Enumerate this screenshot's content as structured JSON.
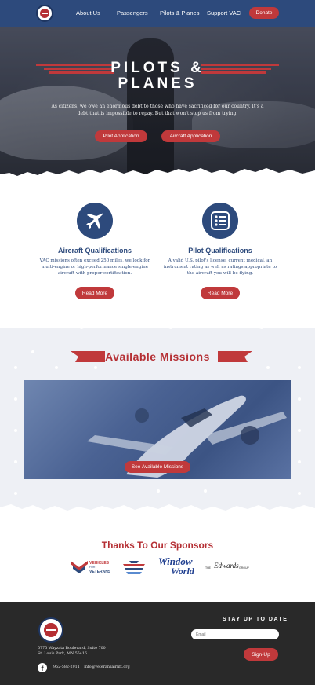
{
  "nav": {
    "links": [
      "About Us",
      "Passengers",
      "Pilots & Planes",
      "Support VAC"
    ],
    "donate_label": "Donate"
  },
  "hero": {
    "title_line1": "PILOTS &",
    "title_line2": "PLANES",
    "text": "As citizens, we owe an enormous debt to those who have sacrificed for our country. It's a debt that is impossible to repay. But that won't stop us from trying.",
    "buttons": [
      "Pilot Application",
      "Aircraft Application"
    ]
  },
  "qualifications": [
    {
      "icon": "airplane-icon",
      "title": "Aircraft Qualifications",
      "text": "VAC missions often exceed 250 miles, we look for multi-engine or high-performance single-engine aircraft with proper certification.",
      "button": "Read More"
    },
    {
      "icon": "checklist-icon",
      "title": "Pilot Qualifications",
      "text": "A valid U.S. pilot's license, current medical, an instrument rating as well as ratings appropriate to the aircraft you will be flying.",
      "button": "Read More"
    }
  ],
  "missions": {
    "title": "Available Missions",
    "button": "See Available Missions"
  },
  "sponsors": {
    "title": "Thanks To Our Sponsors",
    "logos": [
      {
        "line1": "VEHICLES",
        "line2": "VETERANS",
        "for_text": "FOR"
      },
      {
        "name": "airline-logo"
      },
      {
        "line1": "Window",
        "line2": "World"
      },
      {
        "pre": "THE",
        "script": "Edwards",
        "post": "GROUP"
      }
    ]
  },
  "footer": {
    "address_line1": "5775 Wayzata Boulevard, Suite 700",
    "address_line2": "St. Louis Park, MN 55416",
    "phone": "952-582-2911",
    "email": "info@veteransairlift.org",
    "stay_title": "STAY UP TO DATE",
    "email_placeholder": "Email",
    "signup_label": "Sign-Up"
  },
  "colors": {
    "navy": "#2d4a7c",
    "red": "#c0393b",
    "footer_bg": "#292929",
    "section_bg": "#eef0f5"
  }
}
